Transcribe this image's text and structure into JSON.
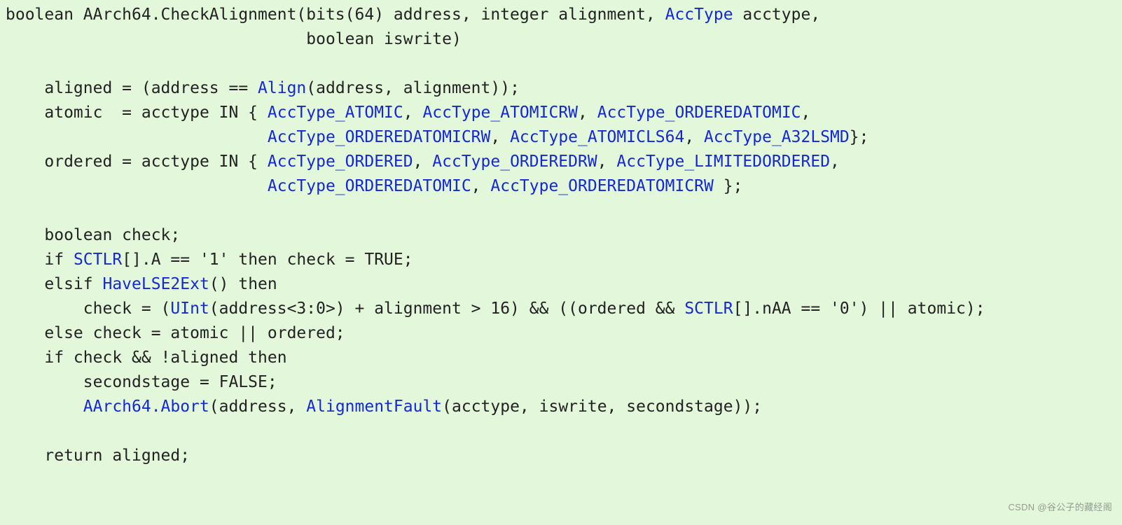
{
  "code": {
    "l1a": "boolean AArch64.CheckAlignment(bits(64) address, integer alignment, ",
    "l1b": "AccType",
    "l1c": " acctype,",
    "l2": "                               boolean iswrite)",
    "l4a": "    aligned = (address == ",
    "l4b": "Align",
    "l4c": "(address, alignment));",
    "l5a": "    atomic  = acctype IN { ",
    "l5b": "AccType_ATOMIC",
    "l5c": ", ",
    "l5d": "AccType_ATOMICRW",
    "l5e": ", ",
    "l5f": "AccType_ORDEREDATOMIC",
    "l5g": ",",
    "l6a": "                           ",
    "l6b": "AccType_ORDEREDATOMICRW",
    "l6c": ", ",
    "l6d": "AccType_ATOMICLS64",
    "l6e": ", ",
    "l6f": "AccType_A32LSMD",
    "l6g": "};",
    "l7a": "    ordered = acctype IN { ",
    "l7b": "AccType_ORDERED",
    "l7c": ", ",
    "l7d": "AccType_ORDEREDRW",
    "l7e": ", ",
    "l7f": "AccType_LIMITEDORDERED",
    "l7g": ",",
    "l8a": "                           ",
    "l8b": "AccType_ORDEREDATOMIC",
    "l8c": ", ",
    "l8d": "AccType_ORDEREDATOMICRW",
    "l8e": " };",
    "l10": "    boolean check;",
    "l11a": "    if ",
    "l11b": "SCTLR",
    "l11c": "[].A == '1' then check = TRUE;",
    "l12a": "    elsif ",
    "l12b": "HaveLSE2Ext",
    "l12c": "() then",
    "l13a": "        check = (",
    "l13b": "UInt",
    "l13c": "(address<3:0>) + alignment > 16) && ((ordered && ",
    "l13d": "SCTLR",
    "l13e": "[].nAA == '0') || atomic);",
    "l14": "    else check = atomic || ordered;",
    "l15": "    if check && !aligned then",
    "l16": "        secondstage = FALSE;",
    "l17a": "        ",
    "l17b": "AArch64.Abort",
    "l17c": "(address, ",
    "l17d": "AlignmentFault",
    "l17e": "(acctype, iswrite, secondstage));",
    "l19": "    return aligned;"
  },
  "watermark": "CSDN @谷公子的藏经阁"
}
